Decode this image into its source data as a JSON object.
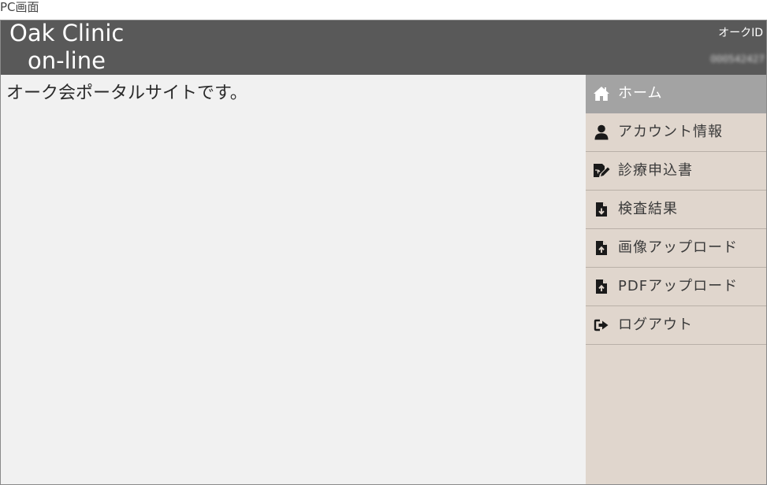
{
  "caption": "PC画面",
  "header": {
    "logo_line1": "Oak Clinic",
    "logo_line2": "on-line",
    "id_label": "オークID",
    "id_value": "000542427"
  },
  "main": {
    "welcome_text": "オーク会ポータルサイトです。"
  },
  "sidebar": {
    "items": [
      {
        "label": "ホーム",
        "icon": "home-icon",
        "active": true
      },
      {
        "label": "アカウント情報",
        "icon": "user-icon",
        "active": false
      },
      {
        "label": "診療申込書",
        "icon": "edit-document-icon",
        "active": false
      },
      {
        "label": "検査結果",
        "icon": "file-download-icon",
        "active": false
      },
      {
        "label": "画像アップロード",
        "icon": "file-upload-icon",
        "active": false
      },
      {
        "label": "PDFアップロード",
        "icon": "file-upload-icon",
        "active": false
      },
      {
        "label": "ログアウト",
        "icon": "logout-icon",
        "active": false
      }
    ]
  },
  "colors": {
    "header_bg": "#595959",
    "main_bg": "#f1f1f1",
    "sidebar_bg": "#e0d6cd",
    "active_item_bg": "#a3a3a3"
  }
}
